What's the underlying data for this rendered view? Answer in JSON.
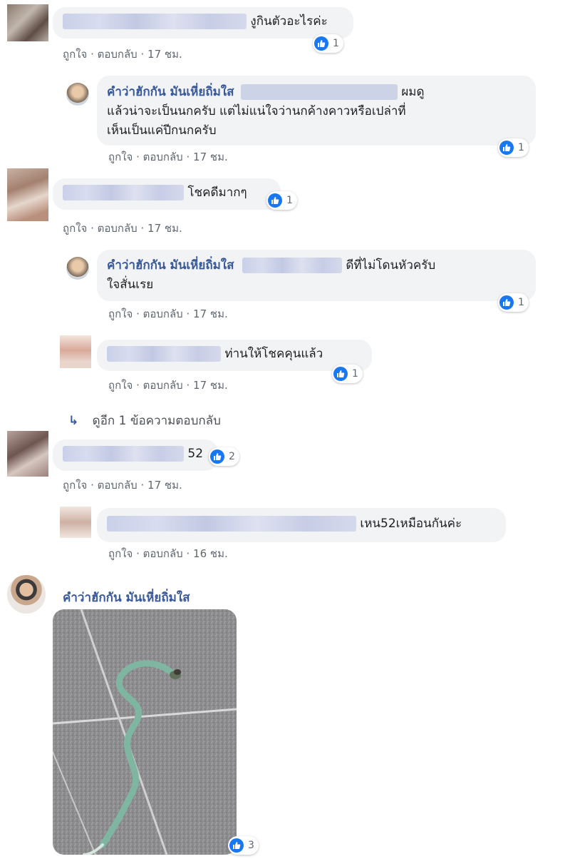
{
  "meta_sep": "·",
  "comments": [
    {
      "text": "งูกินตัวอะไรค่ะ",
      "like": "ถูกใจ",
      "reply": "ตอบกลับ",
      "time": "17 ชม.",
      "reactions": "1"
    },
    {
      "author": "คำว่าฮักกัน มันเหี่ยถิ่มใส",
      "text_a": "ผมดู",
      "text_b": "แล้วน่าจะเป็นนกครับ แต่ไม่แน่ใจว่านกค้างคาวหรือเปล่าที่",
      "text_c": "เห็นเป็นแค่ปีกนกครับ",
      "like": "ถูกใจ",
      "reply": "ตอบกลับ",
      "time": "17 ชม.",
      "reactions": "1"
    },
    {
      "text": "โชคดีมากๆ",
      "like": "ถูกใจ",
      "reply": "ตอบกลับ",
      "time": "17 ชม.",
      "reactions": "1"
    },
    {
      "author": "คำว่าฮักกัน มันเหี่ยถิ่มใส",
      "text_a": "ดีที่ไม่โดนหัวครับ",
      "text_b": "ใจสั่นเรย",
      "like": "ถูกใจ",
      "reply": "ตอบกลับ",
      "time": "17 ชม.",
      "reactions": "1"
    },
    {
      "text": "ท่านให้โชคคุนแล้ว",
      "like": "ถูกใจ",
      "reply": "ตอบกลับ",
      "time": "17 ชม.",
      "reactions": "1"
    },
    {
      "text": "52",
      "like": "ถูกใจ",
      "reply": "ตอบกลับ",
      "time": "17 ชม.",
      "reactions": "2"
    },
    {
      "text": "เหน52เหมือนกันค่ะ",
      "like": "ถูกใจ",
      "reply": "ตอบกลับ",
      "time": "16 ชม."
    }
  ],
  "view_more": {
    "arrow": "↳",
    "label": "ดูอีก 1 ข้อความตอบกลับ"
  },
  "photo_comment": {
    "author": "คำว่าฮักกัน มันเหี่ยถิ่มใส",
    "reactions": "3"
  },
  "colors": {
    "link": "#385898",
    "like_blue": "#1877f2",
    "bubble": "#f2f3f5",
    "meta": "#606770",
    "snake": "#7fb6a2",
    "floor": "#8d8c8e"
  }
}
